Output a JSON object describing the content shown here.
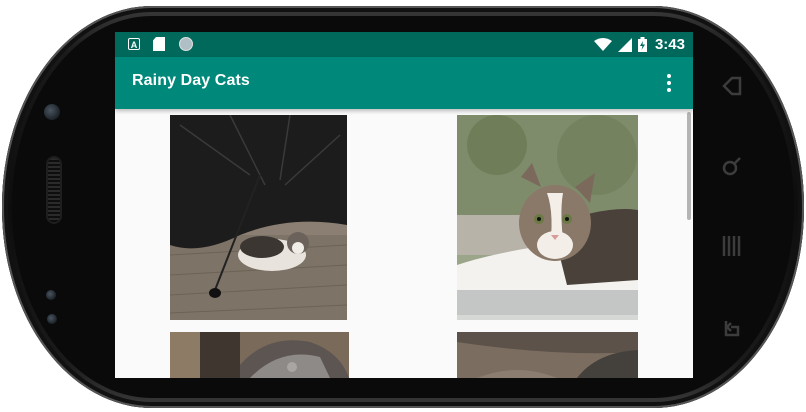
{
  "status_bar": {
    "left_icons": [
      "keyboard-a-icon",
      "sd-card-icon",
      "sync-circle-icon"
    ],
    "right_icons": [
      "wifi-icon",
      "cellular-signal-icon",
      "battery-charging-icon"
    ],
    "time": "3:43",
    "background": "#00695c"
  },
  "app_bar": {
    "title": "Rainy Day Cats",
    "overflow_icon": "more-vert-icon",
    "background": "#00897b"
  },
  "grid": {
    "items": [
      {
        "description_icon": "cat-under-umbrella-photo"
      },
      {
        "description_icon": "cat-on-windowsill-photo"
      },
      {
        "description_icon": "cat-photo-partial-3"
      },
      {
        "description_icon": "cat-photo-partial-4"
      }
    ]
  },
  "device": {
    "hardware_keys": [
      "back-key-icon",
      "search-key-icon",
      "menu-key-icon",
      "home-key-icon"
    ]
  }
}
